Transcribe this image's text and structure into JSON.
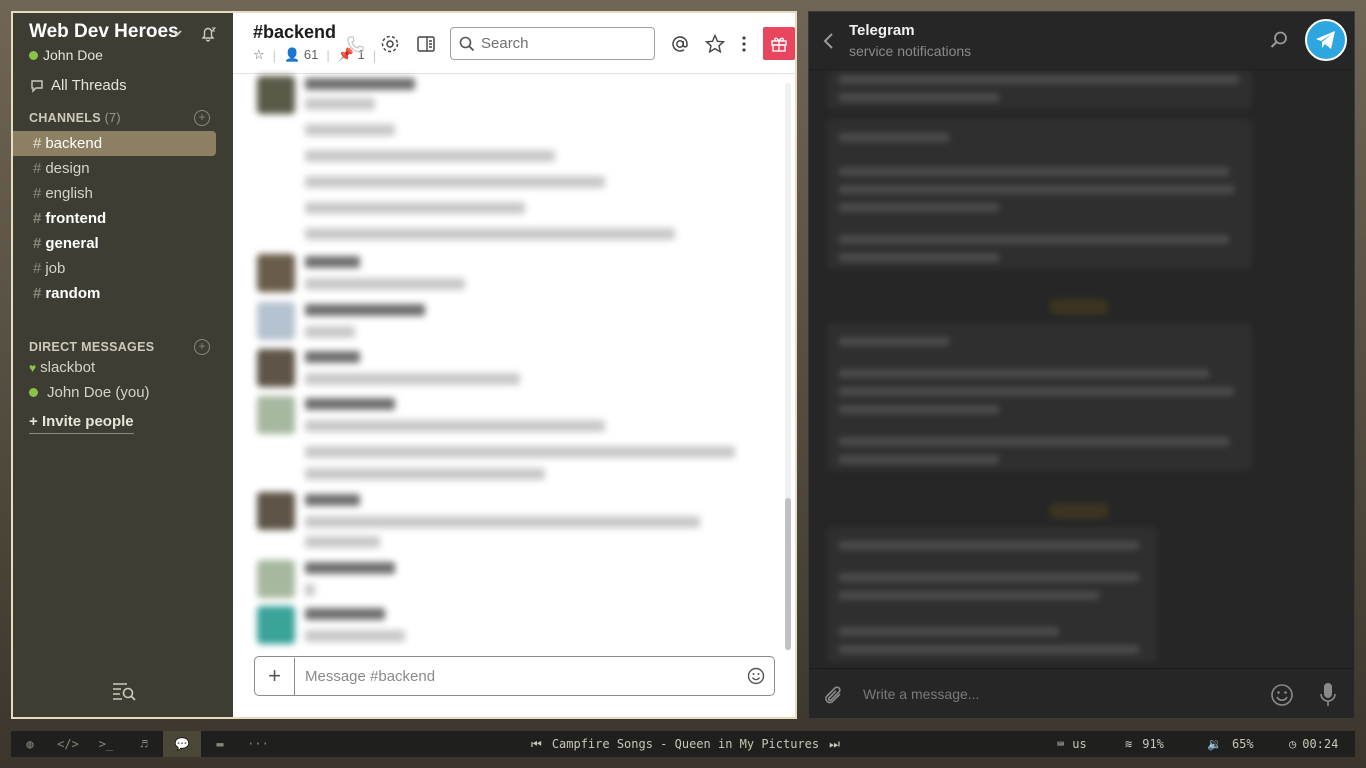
{
  "slack": {
    "workspace": "Web Dev Heroes",
    "user": "John Doe",
    "threads_label": "All Threads",
    "channels_header": "CHANNELS",
    "channels_count": "(7)",
    "channels": [
      {
        "name": "backend",
        "active": true,
        "bold": false
      },
      {
        "name": "design",
        "active": false,
        "bold": false
      },
      {
        "name": "english",
        "active": false,
        "bold": false
      },
      {
        "name": "frontend",
        "active": false,
        "bold": true
      },
      {
        "name": "general",
        "active": false,
        "bold": true
      },
      {
        "name": "job",
        "active": false,
        "bold": false
      },
      {
        "name": "random",
        "active": false,
        "bold": true
      }
    ],
    "dm_header": "DIRECT MESSAGES",
    "dms": [
      "slackbot",
      "John Doe (you)"
    ],
    "invite": "Invite people",
    "channel_title": "#backend",
    "members_count": "61",
    "pinned_count": "1",
    "search_placeholder": "Search",
    "composer_placeholder": "Message #backend",
    "colors": {
      "sidebar": "#3e3d34",
      "active_channel": "#8d7f62",
      "gift": "#e8455e"
    }
  },
  "telegram": {
    "title": "Telegram",
    "subtitle": "service notifications",
    "input_placeholder": "Write a message..."
  },
  "taskbar": {
    "workspaces": [
      "globe-icon",
      "code-icon",
      "terminal-icon",
      "music-icon",
      "chat-icon",
      "folder-icon",
      "more-icon"
    ],
    "active_workspace": 4,
    "track": "Campfire Songs - Queen in My Pictures",
    "keyboard": "us",
    "wifi": "91%",
    "volume": "65%",
    "clock": "00:24"
  }
}
